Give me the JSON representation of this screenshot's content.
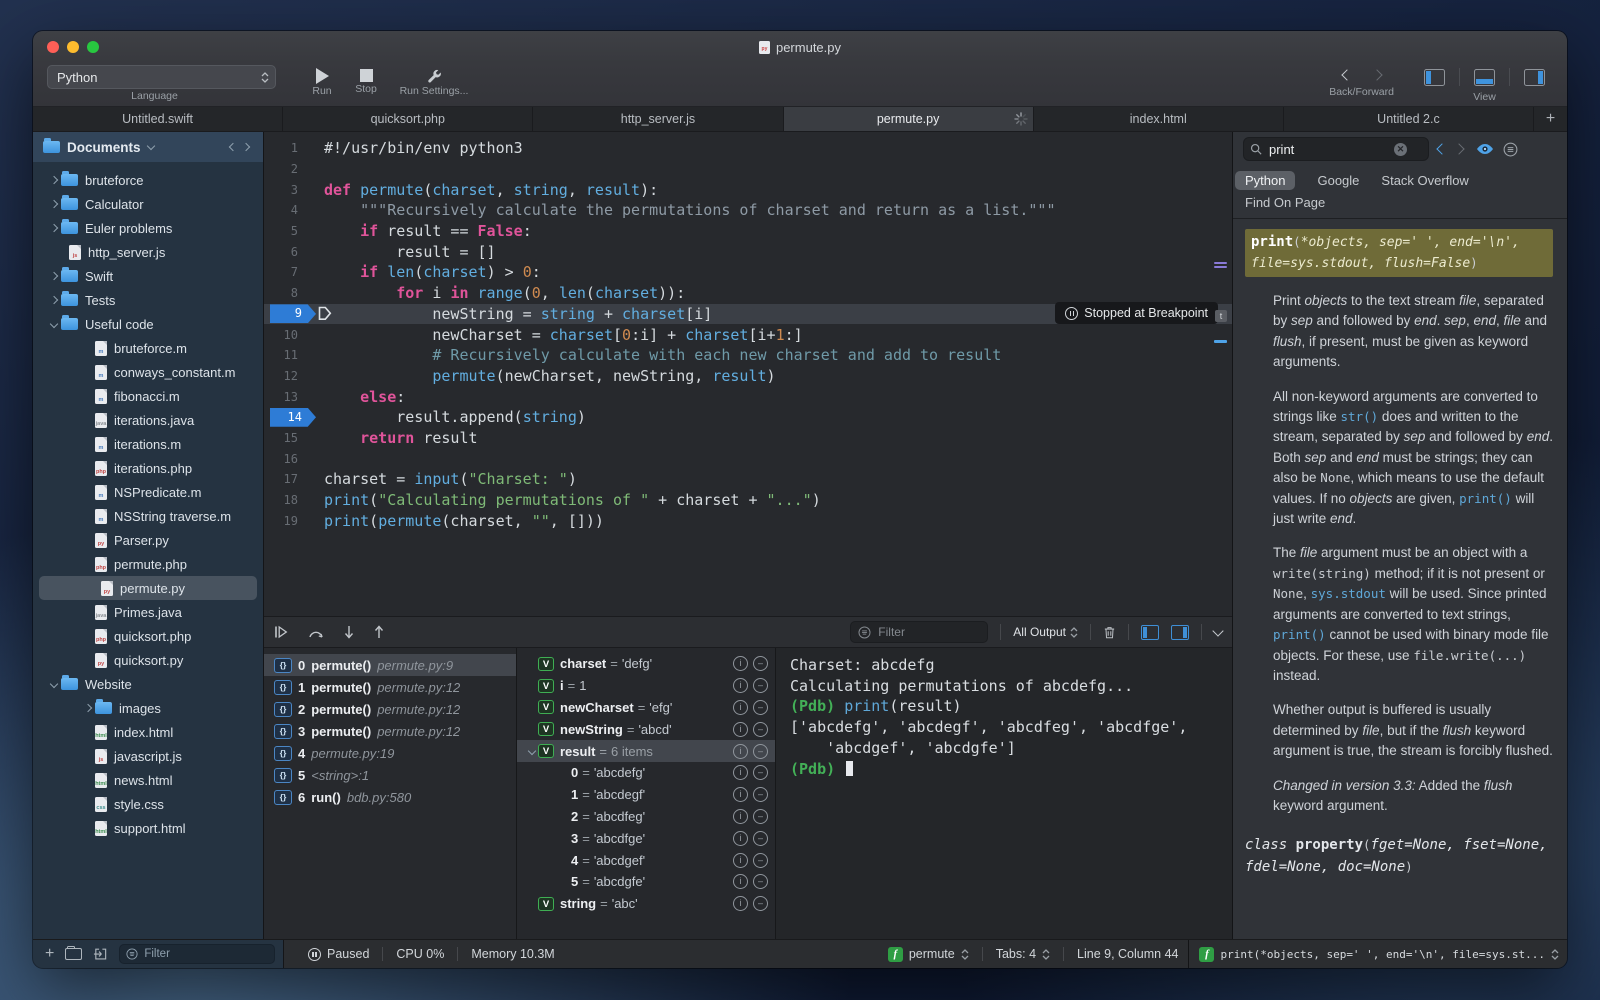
{
  "titlebar": {
    "title": "permute.py"
  },
  "toolbar": {
    "language": {
      "value": "Python",
      "label": "Language"
    },
    "run_label": "Run",
    "stop_label": "Stop",
    "run_settings_label": "Run Settings...",
    "back_forward_label": "Back/Forward",
    "view_label": "View"
  },
  "icons": {
    "run": "play-triangle",
    "stop": "square",
    "run_settings": "wrench",
    "back": "chevron-left",
    "forward": "chevron-right",
    "view": [
      "panel-left",
      "panel-bottom",
      "panel-right"
    ],
    "busy": "spinner",
    "search": "magnifier",
    "clear": "circle-x",
    "eye": "eye",
    "reader": "circled-lines",
    "filter": "circled-lines",
    "trash": "trash",
    "pause": "circled-pause",
    "info": "circled-i",
    "remove": "circled-minus",
    "frame": "braces-badge",
    "variable": "v-badge",
    "function": "f-badge",
    "breakpoint": "blue-arrow-tag",
    "instruction_pointer": "outlined-arrow"
  },
  "tabbar": {
    "tabs": [
      {
        "label": "Untitled.swift"
      },
      {
        "label": "quicksort.php"
      },
      {
        "label": "http_server.js"
      },
      {
        "label": "permute.py",
        "active": true,
        "busy": true
      },
      {
        "label": "index.html"
      },
      {
        "label": "Untitled 2.c"
      }
    ],
    "add": "+"
  },
  "sidebar": {
    "header": {
      "label": "Documents"
    },
    "tree": [
      {
        "type": "folder",
        "label": "bruteforce",
        "depth": 0,
        "disc": "r"
      },
      {
        "type": "folder",
        "label": "Calculator",
        "depth": 0,
        "disc": "r"
      },
      {
        "type": "folder",
        "label": "Euler problems",
        "depth": 0,
        "disc": "r"
      },
      {
        "type": "file",
        "ext": "js",
        "label": "http_server.js",
        "depth": 0
      },
      {
        "type": "folder",
        "label": "Swift",
        "depth": 0,
        "disc": "r"
      },
      {
        "type": "folder",
        "label": "Tests",
        "depth": 0,
        "disc": "r"
      },
      {
        "type": "folder",
        "label": "Useful code",
        "depth": 0,
        "disc": "d"
      },
      {
        "type": "file",
        "ext": "m",
        "label": "bruteforce.m",
        "depth": 1
      },
      {
        "type": "file",
        "ext": "m",
        "label": "conways_constant.m",
        "depth": 1
      },
      {
        "type": "file",
        "ext": "m",
        "label": "fibonacci.m",
        "depth": 1
      },
      {
        "type": "file",
        "ext": "java",
        "label": "iterations.java",
        "depth": 1
      },
      {
        "type": "file",
        "ext": "m",
        "label": "iterations.m",
        "depth": 1
      },
      {
        "type": "file",
        "ext": "php",
        "label": "iterations.php",
        "depth": 1
      },
      {
        "type": "file",
        "ext": "m",
        "label": "NSPredicate.m",
        "depth": 1
      },
      {
        "type": "file",
        "ext": "m",
        "label": "NSString traverse.m",
        "depth": 1
      },
      {
        "type": "file",
        "ext": "py",
        "label": "Parser.py",
        "depth": 1
      },
      {
        "type": "file",
        "ext": "php",
        "label": "permute.php",
        "depth": 1
      },
      {
        "type": "file",
        "ext": "py",
        "label": "permute.py",
        "depth": 1,
        "selected": true
      },
      {
        "type": "file",
        "ext": "java",
        "label": "Primes.java",
        "depth": 1
      },
      {
        "type": "file",
        "ext": "php",
        "label": "quicksort.php",
        "depth": 1
      },
      {
        "type": "file",
        "ext": "py",
        "label": "quicksort.py",
        "depth": 1
      },
      {
        "type": "folder",
        "label": "Website",
        "depth": 0,
        "disc": "d"
      },
      {
        "type": "folder",
        "label": "images",
        "depth": 1,
        "disc": "r"
      },
      {
        "type": "file",
        "ext": "html",
        "label": "index.html",
        "depth": 1
      },
      {
        "type": "file",
        "ext": "js",
        "label": "javascript.js",
        "depth": 1
      },
      {
        "type": "file",
        "ext": "html",
        "label": "news.html",
        "depth": 1
      },
      {
        "type": "file",
        "ext": "css",
        "label": "style.css",
        "depth": 1
      },
      {
        "type": "file",
        "ext": "html",
        "label": "support.html",
        "depth": 1
      }
    ]
  },
  "editor": {
    "badge": "Stopped at Breakpoint",
    "lines": [
      {
        "n": 1,
        "s": [
          [
            "pl",
            "#!/usr/bin/env python3"
          ]
        ]
      },
      {
        "n": 2,
        "s": []
      },
      {
        "n": 3,
        "s": [
          [
            "kw",
            "def"
          ],
          [
            "pl",
            " "
          ],
          [
            "fn",
            "permute"
          ],
          [
            "pl",
            "("
          ],
          [
            "fn",
            "charset"
          ],
          [
            "pl",
            ", "
          ],
          [
            "fn",
            "string"
          ],
          [
            "pl",
            ", "
          ],
          [
            "fn",
            "result"
          ],
          [
            "pl",
            "):"
          ]
        ]
      },
      {
        "n": 4,
        "s": [
          [
            "doc",
            "    \"\"\"Recursively calculate the permutations of charset and return as a list.\"\"\""
          ]
        ]
      },
      {
        "n": 5,
        "s": [
          [
            "pl",
            "    "
          ],
          [
            "kw",
            "if"
          ],
          [
            "pl",
            " result == "
          ],
          [
            "kw",
            "False"
          ],
          [
            "pl",
            ":"
          ]
        ]
      },
      {
        "n": 6,
        "s": [
          [
            "pl",
            "        result = []"
          ]
        ]
      },
      {
        "n": 7,
        "s": [
          [
            "pl",
            "    "
          ],
          [
            "kw",
            "if"
          ],
          [
            "pl",
            " "
          ],
          [
            "fn",
            "len"
          ],
          [
            "pl",
            "("
          ],
          [
            "fn",
            "charset"
          ],
          [
            "pl",
            ") > "
          ],
          [
            "num",
            "0"
          ],
          [
            "pl",
            ":"
          ]
        ]
      },
      {
        "n": 8,
        "s": [
          [
            "pl",
            "        "
          ],
          [
            "kw",
            "for"
          ],
          [
            "pl",
            " i "
          ],
          [
            "kw",
            "in"
          ],
          [
            "pl",
            " "
          ],
          [
            "fn",
            "range"
          ],
          [
            "pl",
            "("
          ],
          [
            "num",
            "0"
          ],
          [
            "pl",
            ", "
          ],
          [
            "fn",
            "len"
          ],
          [
            "pl",
            "("
          ],
          [
            "fn",
            "charset"
          ],
          [
            "pl",
            ")):"
          ]
        ]
      },
      {
        "n": 9,
        "bp": "current",
        "s": [
          [
            "pl",
            "            newString = "
          ],
          [
            "fn",
            "string"
          ],
          [
            "pl",
            " + "
          ],
          [
            "fn",
            "charset"
          ],
          [
            "pl",
            "[i]"
          ]
        ]
      },
      {
        "n": 10,
        "s": [
          [
            "pl",
            "            newCharset = "
          ],
          [
            "fn",
            "charset"
          ],
          [
            "pl",
            "["
          ],
          [
            "num",
            "0"
          ],
          [
            "pl",
            ":i] + "
          ],
          [
            "fn",
            "charset"
          ],
          [
            "pl",
            "[i+"
          ],
          [
            "num",
            "1"
          ],
          [
            "pl",
            ":]"
          ]
        ]
      },
      {
        "n": 11,
        "s": [
          [
            "cm",
            "            # Recursively calculate with each new charset and add to result"
          ]
        ]
      },
      {
        "n": 12,
        "s": [
          [
            "pl",
            "            "
          ],
          [
            "fn",
            "permute"
          ],
          [
            "pl",
            "(newCharset, newString, "
          ],
          [
            "fn",
            "result"
          ],
          [
            "pl",
            ")"
          ]
        ]
      },
      {
        "n": 13,
        "s": [
          [
            "pl",
            "    "
          ],
          [
            "kw",
            "else"
          ],
          [
            "pl",
            ":"
          ]
        ]
      },
      {
        "n": 14,
        "bp": "set",
        "s": [
          [
            "pl",
            "        result.append("
          ],
          [
            "fn",
            "string"
          ],
          [
            "pl",
            ")"
          ]
        ]
      },
      {
        "n": 15,
        "s": [
          [
            "pl",
            "    "
          ],
          [
            "kw",
            "return"
          ],
          [
            "pl",
            " result"
          ]
        ]
      },
      {
        "n": 16,
        "s": []
      },
      {
        "n": 17,
        "s": [
          [
            "pl",
            "charset = "
          ],
          [
            "fn",
            "input"
          ],
          [
            "pl",
            "("
          ],
          [
            "st",
            "\"Charset: \""
          ],
          [
            "pl",
            ")"
          ]
        ]
      },
      {
        "n": 18,
        "s": [
          [
            "fn",
            "print"
          ],
          [
            "pl",
            "("
          ],
          [
            "st",
            "\"Calculating permutations of \""
          ],
          [
            "pl",
            " + charset + "
          ],
          [
            "st",
            "\"...\""
          ],
          [
            "pl",
            ")"
          ]
        ]
      },
      {
        "n": 19,
        "s": [
          [
            "fn",
            "print"
          ],
          [
            "pl",
            "("
          ],
          [
            "fn",
            "permute"
          ],
          [
            "pl",
            "(charset, "
          ],
          [
            "st",
            "\"\""
          ],
          [
            "pl",
            ", []))"
          ]
        ]
      }
    ]
  },
  "debug": {
    "filter_placeholder": "Filter",
    "output_mode": "All Output",
    "frames": [
      {
        "i": "0",
        "fn": "permute()",
        "loc": "permute.py:9",
        "sel": true
      },
      {
        "i": "1",
        "fn": "permute()",
        "loc": "permute.py:12"
      },
      {
        "i": "2",
        "fn": "permute()",
        "loc": "permute.py:12"
      },
      {
        "i": "3",
        "fn": "permute()",
        "loc": "permute.py:12"
      },
      {
        "i": "4",
        "fn": "",
        "loc": "permute.py:19"
      },
      {
        "i": "5",
        "fn": "",
        "loc": "<string>:1"
      },
      {
        "i": "6",
        "fn": "run()",
        "loc": "bdb.py:580"
      }
    ],
    "variables": [
      {
        "v": true,
        "name": "charset",
        "value": "'defg'"
      },
      {
        "v": true,
        "name": "i",
        "value": "1"
      },
      {
        "v": true,
        "name": "newCharset",
        "value": "'efg'"
      },
      {
        "v": true,
        "name": "newString",
        "value": "'abcd'"
      },
      {
        "v": true,
        "chev": true,
        "name": "result",
        "value": "6 items",
        "muted": true,
        "sel": true
      },
      {
        "child": true,
        "name": "0",
        "value": "'abcdefg'"
      },
      {
        "child": true,
        "name": "1",
        "value": "'abcdegf'"
      },
      {
        "child": true,
        "name": "2",
        "value": "'abcdfeg'"
      },
      {
        "child": true,
        "name": "3",
        "value": "'abcdfge'"
      },
      {
        "child": true,
        "name": "4",
        "value": "'abcdgef'"
      },
      {
        "child": true,
        "name": "5",
        "value": "'abcdgfe'"
      },
      {
        "v": true,
        "name": "string",
        "value": "'abc'"
      }
    ],
    "console": [
      [
        [
          "t",
          "Charset: abcdefg"
        ]
      ],
      [
        [
          "t",
          "Calculating permutations of abcdefg..."
        ]
      ],
      [
        [
          "pdb",
          "(Pdb) "
        ],
        [
          "fn",
          "print"
        ],
        [
          "t",
          "(result)"
        ]
      ],
      [
        [
          "t",
          "['abcdefg', 'abcdegf', 'abcdfeg', 'abcdfge',"
        ]
      ],
      [
        [
          "t",
          "    'abcdgef', 'abcdgfe']"
        ]
      ],
      [
        [
          "pdb",
          "(Pdb) "
        ],
        [
          "cursor",
          ""
        ]
      ]
    ]
  },
  "docs": {
    "search": {
      "value": "print"
    },
    "tabs": {
      "python": "Python",
      "google": "Google",
      "stackoverflow": "Stack Overflow",
      "find_on_page": "Find On Page"
    },
    "sections": [
      {
        "kind": "sig",
        "spans": [
          [
            "b",
            "print"
          ],
          [
            "c",
            "("
          ],
          [
            "ci",
            "*objects, sep=' ', end='\\n', file=sys.stdout, flush=False"
          ],
          [
            "c",
            ")"
          ]
        ]
      },
      {
        "kind": "p",
        "spans": [
          [
            "n",
            "Print "
          ],
          [
            "i",
            "objects"
          ],
          [
            "n",
            " to the text stream "
          ],
          [
            "i",
            "file"
          ],
          [
            "n",
            ", separated by "
          ],
          [
            "i",
            "sep"
          ],
          [
            "n",
            " and followed by "
          ],
          [
            "i",
            "end"
          ],
          [
            "n",
            ". "
          ],
          [
            "i",
            "sep"
          ],
          [
            "n",
            ", "
          ],
          [
            "i",
            "end"
          ],
          [
            "n",
            ", "
          ],
          [
            "i",
            "file"
          ],
          [
            "n",
            " and "
          ],
          [
            "i",
            "flush"
          ],
          [
            "n",
            ", if present, must be given as keyword arguments."
          ]
        ]
      },
      {
        "kind": "p",
        "spans": [
          [
            "n",
            "All non-keyword arguments are converted to strings like "
          ],
          [
            "cb",
            "str()"
          ],
          [
            "n",
            " does and written to the stream, separated by "
          ],
          [
            "i",
            "sep"
          ],
          [
            "n",
            " and followed by "
          ],
          [
            "i",
            "end"
          ],
          [
            "n",
            ". Both "
          ],
          [
            "i",
            "sep"
          ],
          [
            "n",
            " and "
          ],
          [
            "i",
            "end"
          ],
          [
            "n",
            " must be strings; they can also be "
          ],
          [
            "c",
            "None"
          ],
          [
            "n",
            ", which means to use the default values. If no "
          ],
          [
            "i",
            "objects"
          ],
          [
            "n",
            " are given, "
          ],
          [
            "cb",
            "print()"
          ],
          [
            "n",
            " will just write "
          ],
          [
            "i",
            "end"
          ],
          [
            "n",
            "."
          ]
        ]
      },
      {
        "kind": "p",
        "spans": [
          [
            "n",
            "The "
          ],
          [
            "i",
            "file"
          ],
          [
            "n",
            " argument must be an object with a "
          ],
          [
            "c",
            "write(string)"
          ],
          [
            "n",
            " method; if it is not present or "
          ],
          [
            "c",
            "None"
          ],
          [
            "n",
            ", "
          ],
          [
            "cb",
            "sys.stdout"
          ],
          [
            "n",
            " will be used. Since printed arguments are converted to text strings, "
          ],
          [
            "cb",
            "print()"
          ],
          [
            "n",
            " cannot be used with binary mode file objects. For these, use "
          ],
          [
            "c",
            "file.write(...)"
          ],
          [
            "n",
            " instead."
          ]
        ]
      },
      {
        "kind": "p",
        "spans": [
          [
            "n",
            "Whether output is buffered is usually determined by "
          ],
          [
            "i",
            "file"
          ],
          [
            "n",
            ", but if the "
          ],
          [
            "i",
            "flush"
          ],
          [
            "n",
            " keyword argument is true, the stream is forcibly flushed."
          ]
        ]
      },
      {
        "kind": "p",
        "spans": [
          [
            "i",
            "Changed in version 3.3:"
          ],
          [
            "n",
            " Added the "
          ],
          [
            "i",
            "flush"
          ],
          [
            "n",
            " keyword argument."
          ]
        ]
      },
      {
        "kind": "sig2",
        "spans": [
          [
            "i",
            "class "
          ],
          [
            "b",
            "property"
          ],
          [
            "c",
            "("
          ],
          [
            "ci",
            "fget=None, fset=None, fdel=None, doc=None"
          ],
          [
            "c",
            ")"
          ]
        ]
      }
    ],
    "footer": {
      "text": "print(*objects, sep=' ', end='\\n', file=sys.st..."
    }
  },
  "statusbar": {
    "filter_placeholder": "Filter",
    "paused": "Paused",
    "cpu": "CPU 0%",
    "memory": "Memory 10.3M",
    "scope": "permute",
    "tabs": "Tabs: 4",
    "position": "Line 9, Column 44"
  }
}
